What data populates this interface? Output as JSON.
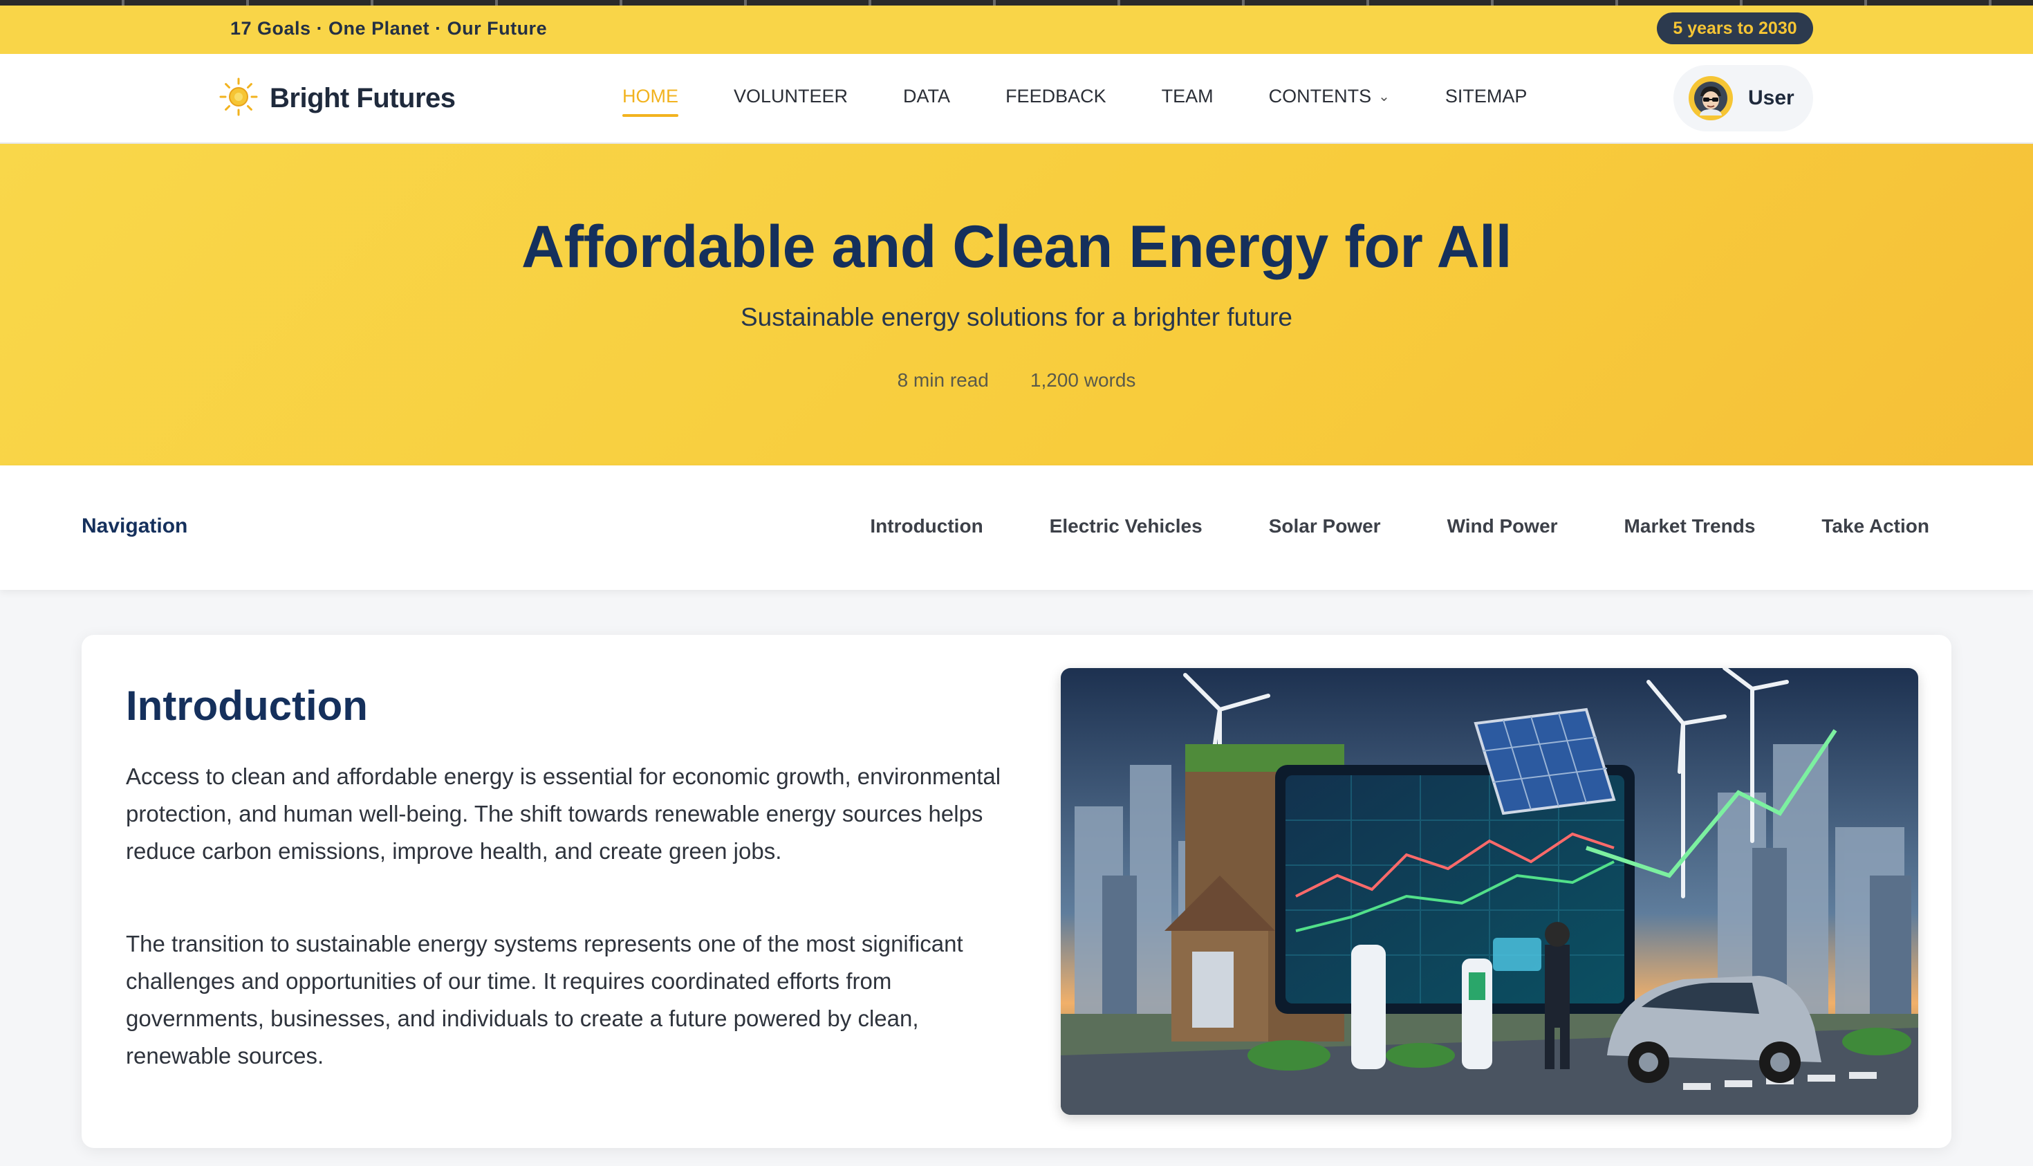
{
  "topbar": {
    "slogan": "17 Goals · One Planet · Our Future",
    "countdown": "5 years to 2030"
  },
  "brand": {
    "name": "Bright Futures",
    "logo_icon": "sun-icon"
  },
  "nav": {
    "items": [
      {
        "label": "HOME",
        "active": true
      },
      {
        "label": "VOLUNTEER",
        "active": false
      },
      {
        "label": "DATA",
        "active": false
      },
      {
        "label": "FEEDBACK",
        "active": false
      },
      {
        "label": "TEAM",
        "active": false
      },
      {
        "label": "CONTENTS",
        "active": false,
        "dropdown": true
      },
      {
        "label": "SITEMAP",
        "active": false
      }
    ],
    "user_label": "User"
  },
  "hero": {
    "title": "Affordable and Clean Energy for All",
    "subtitle": "Sustainable energy solutions for a brighter future",
    "read_time": "8 min read",
    "word_count": "1,200 words"
  },
  "section_nav": {
    "title": "Navigation",
    "links": [
      "Introduction",
      "Electric Vehicles",
      "Solar Power",
      "Wind Power",
      "Market Trends",
      "Take Action"
    ]
  },
  "intro": {
    "heading": "Introduction",
    "paragraphs": [
      "Access to clean and affordable energy is essential for economic growth, environmental protection, and human well-being. The shift towards renewable energy sources helps reduce carbon emissions, improve health, and create green jobs.",
      "The transition to sustainable energy systems represents one of the most significant challenges and opportunities of our time. It requires coordinated efforts from governments, businesses, and individuals to create a future powered by clean, renewable sources."
    ]
  },
  "colors": {
    "brand_yellow": "#f9d548",
    "accent": "#f2b31f",
    "navy": "#15305c"
  }
}
